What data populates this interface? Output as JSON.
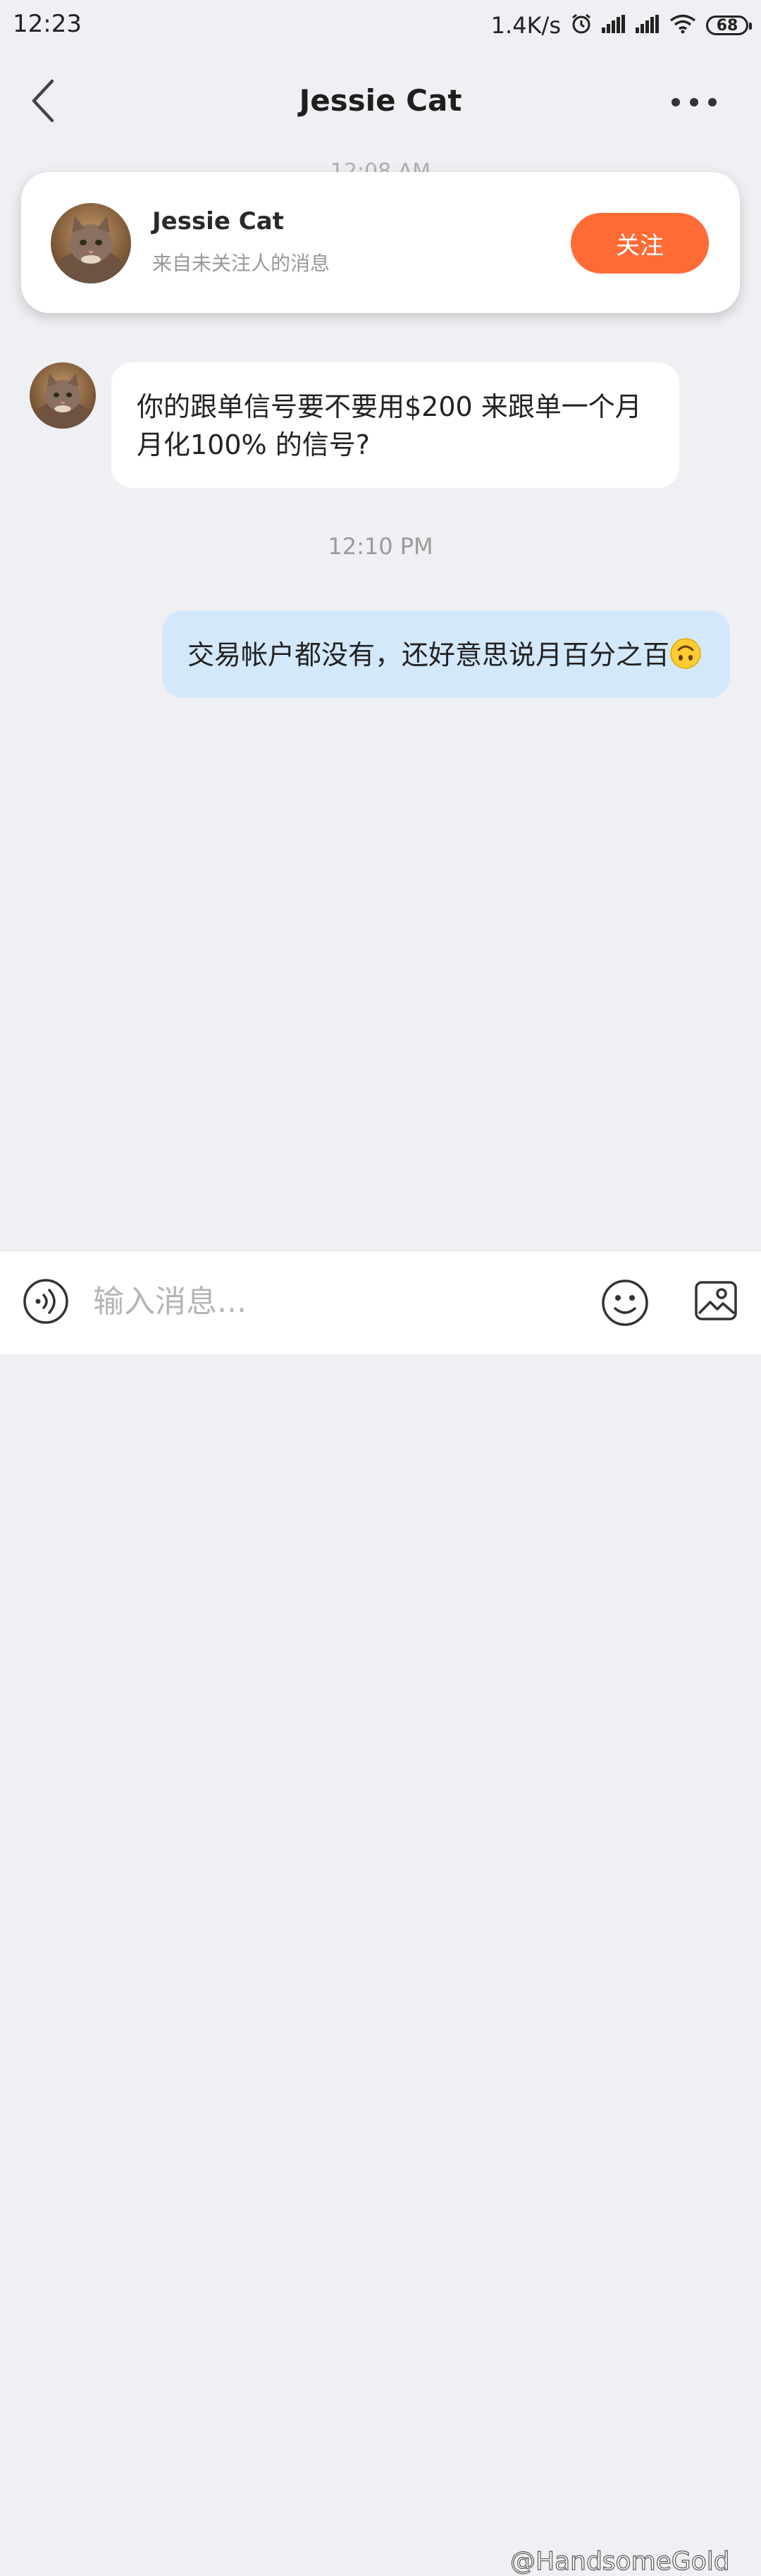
{
  "status_bar": {
    "time": "12:23",
    "net_speed": "1.4K/s",
    "battery": "68",
    "icons": [
      "alarm-icon",
      "signal-icon",
      "signal-icon",
      "wifi-icon",
      "battery-icon"
    ]
  },
  "header": {
    "title": "Jessie Cat",
    "back_icon": "chevron-left-icon",
    "more_icon": "more-dots-icon"
  },
  "hidden_timestamp": "12:08 AM",
  "follow_card": {
    "name": "Jessie Cat",
    "subtitle": "来自未关注人的消息",
    "button_label": "关注",
    "button_color": "#ff6b35"
  },
  "messages": [
    {
      "direction": "incoming",
      "text": "你的跟单信号要不要用$200 来跟单一个月月化100% 的信号?"
    },
    {
      "timestamp": "12:10 PM"
    },
    {
      "direction": "outgoing",
      "text": "交易帐户都没有，还好意思说月百分之百",
      "emoji": "upside-down-face-emoji"
    }
  ],
  "input_bar": {
    "placeholder": "输入消息...",
    "value": "",
    "voice_icon": "voice-icon",
    "emoji_icon": "smiley-icon",
    "image_icon": "image-icon"
  },
  "watermark": "@HandsomeGold",
  "colors": {
    "background": "#eff0f3",
    "outgoing_bubble": "#d3e8fb",
    "incoming_bubble": "#ffffff",
    "accent": "#ff6b35"
  }
}
